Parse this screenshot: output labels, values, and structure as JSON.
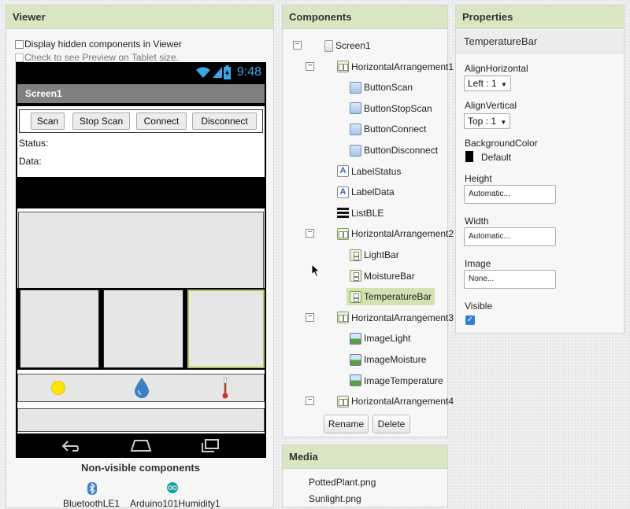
{
  "viewer": {
    "title": "Viewer",
    "hidden_components_label": "Display hidden components in Viewer",
    "tablet_preview_label": "Check to see Preview on Tablet size.",
    "phone": {
      "time": "9:48",
      "screen_title": "Screen1",
      "buttons": [
        "Scan",
        "Stop Scan",
        "Connect",
        "Disconnect"
      ],
      "status_label": "Status:",
      "data_label": "Data:"
    },
    "nonvisible_title": "Non-visible components",
    "nonvisible_items": [
      "BluetoothLE1",
      "Arduino101Humidity1"
    ]
  },
  "components": {
    "title": "Components",
    "tree": [
      {
        "label": "Screen1",
        "icon": "screen-icon",
        "level": 0,
        "toggle": "−"
      },
      {
        "label": "HorizontalArrangement1",
        "icon": "horizontal-arrangement-icon",
        "level": 1,
        "toggle": "−"
      },
      {
        "label": "ButtonScan",
        "icon": "button-icon",
        "level": 2
      },
      {
        "label": "ButtonStopScan",
        "icon": "button-icon",
        "level": 2
      },
      {
        "label": "ButtonConnect",
        "icon": "button-icon",
        "level": 2
      },
      {
        "label": "ButtonDisconnect",
        "icon": "button-icon",
        "level": 2
      },
      {
        "label": "LabelStatus",
        "icon": "label-icon",
        "level": 1
      },
      {
        "label": "LabelData",
        "icon": "label-icon",
        "level": 1
      },
      {
        "label": "ListBLE",
        "icon": "listview-icon",
        "level": 1
      },
      {
        "label": "HorizontalArrangement2",
        "icon": "horizontal-arrangement-icon",
        "level": 1,
        "toggle": "−"
      },
      {
        "label": "LightBar",
        "icon": "vertical-arrangement-icon",
        "level": 2
      },
      {
        "label": "MoistureBar",
        "icon": "vertical-arrangement-icon",
        "level": 2
      },
      {
        "label": "TemperatureBar",
        "icon": "vertical-arrangement-icon",
        "level": 2,
        "selected": true
      },
      {
        "label": "HorizontalArrangement3",
        "icon": "horizontal-arrangement-icon",
        "level": 1,
        "toggle": "−"
      },
      {
        "label": "ImageLight",
        "icon": "image-icon",
        "level": 2
      },
      {
        "label": "ImageMoisture",
        "icon": "image-icon",
        "level": 2
      },
      {
        "label": "ImageTemperature",
        "icon": "image-icon",
        "level": 2
      },
      {
        "label": "HorizontalArrangement4",
        "icon": "horizontal-arrangement-icon",
        "level": 1,
        "toggle": "−"
      }
    ],
    "rename_label": "Rename",
    "delete_label": "Delete"
  },
  "media": {
    "title": "Media",
    "items": [
      "PottedPlant.png",
      "Sunlight.png"
    ]
  },
  "properties": {
    "title": "Properties",
    "component": "TemperatureBar",
    "align_horizontal_label": "AlignHorizontal",
    "align_horizontal_value": "Left : 1",
    "align_vertical_label": "AlignVertical",
    "align_vertical_value": "Top : 1",
    "background_color_label": "BackgroundColor",
    "background_color_value": "Default",
    "height_label": "Height",
    "height_value": "Automatic...",
    "width_label": "Width",
    "width_value": "Automatic...",
    "image_label": "Image",
    "image_value": "None...",
    "visible_label": "Visible",
    "visible_checked": true
  },
  "colors": {
    "panel_header": "#d9e6c4",
    "selection": "#d2e3b0",
    "clock": "#3ea6e6",
    "sun": "#ffe600",
    "water_drop": "#3b7fc4",
    "thermometer": "#c0392b",
    "selected_bar_border": "#a8c95a"
  }
}
